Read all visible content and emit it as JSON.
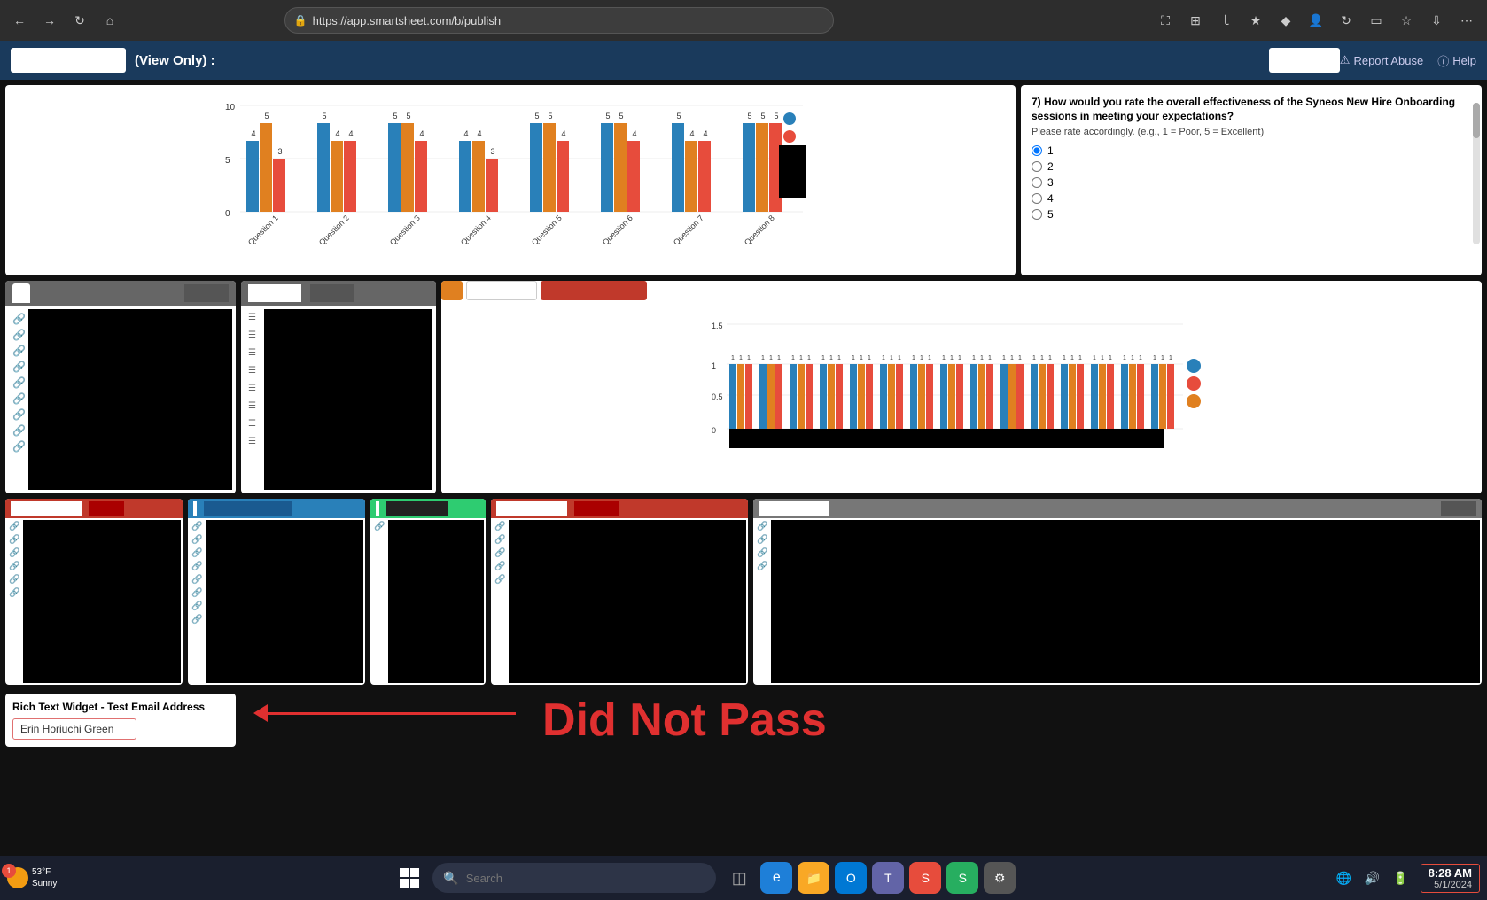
{
  "browser": {
    "url": "https://app.smartsheet.com/b/publish",
    "back_label": "←",
    "forward_label": "→",
    "refresh_label": "↻",
    "home_label": "⌂"
  },
  "app_header": {
    "title": "(View Only) :",
    "report_abuse": "Report Abuse",
    "help": "Help"
  },
  "chart_row1": {
    "y_max": "10",
    "y_mid": "5",
    "y_min": "0",
    "questions": [
      "Question 1",
      "Question 2",
      "Question 3",
      "Question 4",
      "Question 5",
      "Question 6",
      "Question 7",
      "Question 8"
    ],
    "bar_values": [
      [
        4,
        5,
        3
      ],
      [
        5,
        4,
        4
      ],
      [
        5,
        5,
        4
      ],
      [
        4,
        4,
        3
      ],
      [
        5,
        5,
        4
      ],
      [
        5,
        5,
        4
      ],
      [
        5,
        4,
        4
      ],
      [
        5,
        5,
        5
      ]
    ]
  },
  "survey": {
    "question": "7) How would you rate the overall effectiveness of the Syneos New Hire Onboarding sessions in meeting your expectations?",
    "subtitle": "Please rate accordingly. (e.g., 1 = Poor, 5 = Excellent)",
    "options": [
      "1",
      "2",
      "3",
      "4",
      "5"
    ],
    "selected": "1"
  },
  "panels_row2": {
    "panel1_tab": "",
    "panel2_tab": "",
    "chart_tabs": [
      "",
      "",
      ""
    ]
  },
  "panels_row3": {
    "headers": [
      "red",
      "blue",
      "teal",
      "red",
      "gray"
    ]
  },
  "rich_text": {
    "title": "Rich Text Widget - Test Email Address",
    "value": "Erin Horiuchi Green",
    "annotation": "Did Not Pass"
  },
  "taskbar": {
    "weather_temp": "53°F",
    "weather_desc": "Sunny",
    "weather_badge": "1",
    "search_placeholder": "Search",
    "clock_time": "8:28 AM",
    "clock_date": "5/1/2024"
  },
  "legend": {
    "dot1_color": "#2980b9",
    "dot2_color": "#e74c3c",
    "dot3_color": "#e08020"
  }
}
